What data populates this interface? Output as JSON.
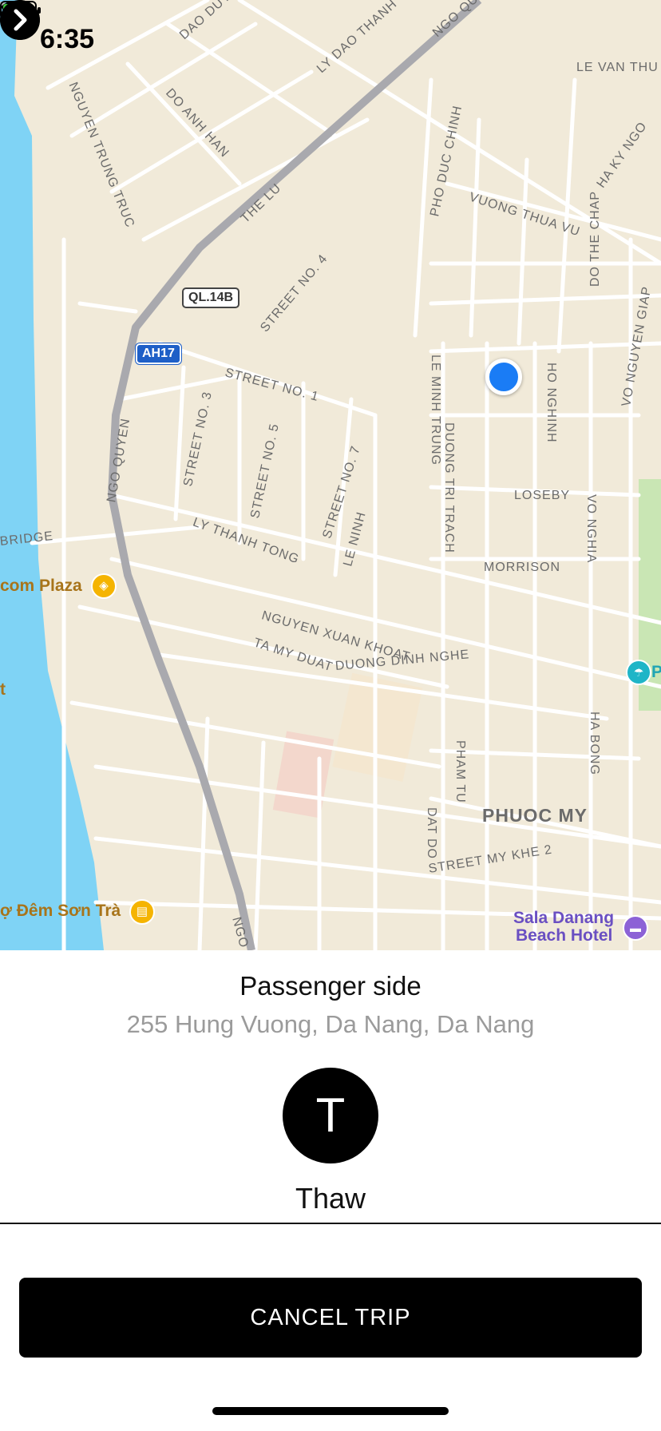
{
  "status_bar": {
    "time": "6:35"
  },
  "map": {
    "streets": [
      "DAO DUY",
      "LY DAO THANH",
      "NGO QUYEN",
      "LE VAN THU",
      "DO ANH HAN",
      "NGUYEN TRUNG TRUC",
      "PHO DUC CHINH",
      "HA KY NGO",
      "THE LU",
      "VUONG THUA VU",
      "STREET NO. 4",
      "LE MINH TRUNG",
      "DO THE CHAP",
      "HO NGHINH",
      "VO NGUYEN GIAP",
      "STREET NO. 1",
      "STREET NO. 3",
      "NGO QUYEN",
      "STREET NO. 5",
      "STREET NO. 7",
      "DUONG TRI TRACH",
      "LOSEBY",
      "VO NGHIA",
      "BRIDGE",
      "LY THANH TONG",
      "LE NINH",
      "MORRISON",
      "NGUYEN XUAN KHOAT",
      "TA MY DUAT",
      "DUONG DINH NGHE",
      "HA BONG",
      "PHAM TU",
      "DAT DO",
      "STREET MY KHE 2",
      "NGO Q"
    ],
    "highway_shields": [
      "QL.14B",
      "AH17"
    ],
    "district": "PHUOC MY",
    "pois": {
      "plaza": "com Plaza",
      "market": "ợ Đêm Sơn Trà",
      "hotel_line1": "Sala Danang",
      "hotel_line2": "Beach Hotel",
      "beach_partial": "P",
      "edge_partial": "t"
    }
  },
  "pickup": {
    "title": "Passenger side",
    "address": "255 Hung Vuong, Da Nang, Da Nang"
  },
  "driver": {
    "initial": "T",
    "name": "Thaw"
  },
  "actions": {
    "cancel_label": "CANCEL TRIP"
  },
  "colors": {
    "map_background": "#f1ead9",
    "water": "#7fd3f5",
    "park": "#c9e6b4",
    "route": "#a9a9ae",
    "user_location": "#1a7cf5"
  }
}
